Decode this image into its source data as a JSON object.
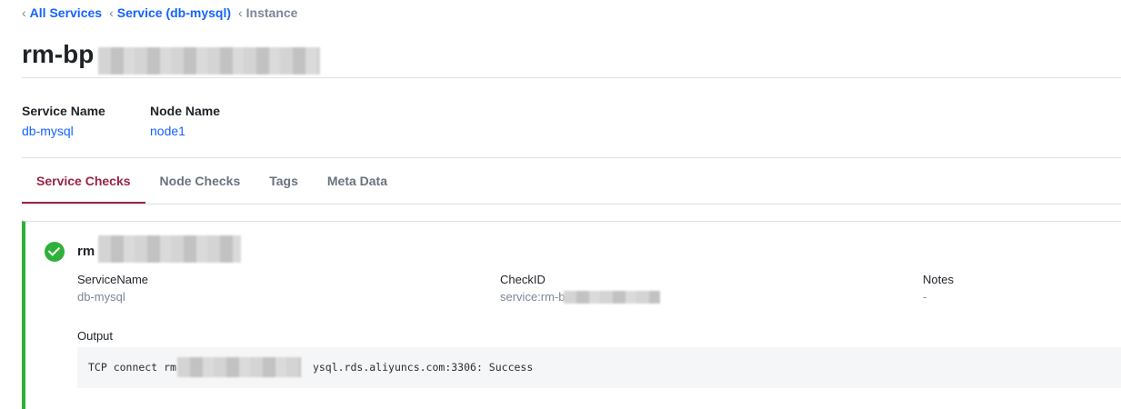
{
  "breadcrumb": {
    "all_services": "All Services",
    "service": "Service (db-mysql)",
    "current": "Instance"
  },
  "page": {
    "title_prefix": "rm-bp"
  },
  "service_meta": {
    "service_name_label": "Service Name",
    "service_name_value": "db-mysql",
    "node_name_label": "Node Name",
    "node_name_value": "node1"
  },
  "tabs": [
    {
      "label": "Service Checks",
      "active": true
    },
    {
      "label": "Node Checks",
      "active": false
    },
    {
      "label": "Tags",
      "active": false
    },
    {
      "label": "Meta Data",
      "active": false
    }
  ],
  "check": {
    "status": "passing",
    "status_color": "#2eb039",
    "name_prefix": "rm",
    "service_name_label": "ServiceName",
    "service_name_value": "db-mysql",
    "check_id_label": "CheckID",
    "check_id_value": "service:rm-b",
    "notes_label": "Notes",
    "notes_value": "-",
    "output_label": "Output",
    "output_prefix": "TCP connect rm",
    "output_suffix": "ysql.rds.aliyuncs.com:3306: Success"
  },
  "colors": {
    "link": "#1563ff",
    "active_tab": "#9b2445",
    "success": "#2eb039"
  }
}
